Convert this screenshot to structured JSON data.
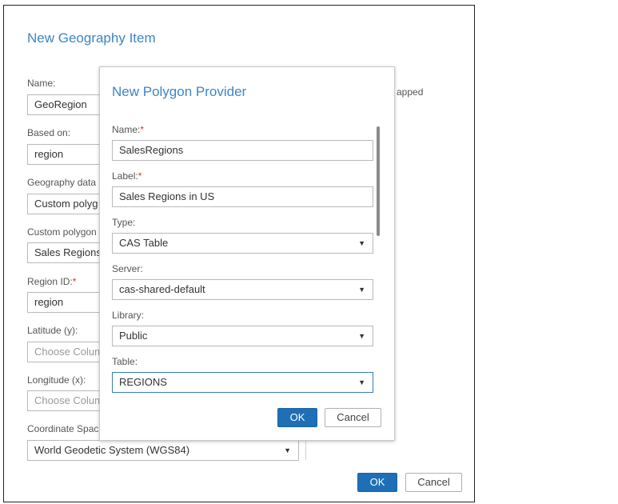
{
  "back_dialog": {
    "title": "New Geography Item",
    "name_label": "Name:",
    "name_value": "GeoRegion",
    "mapped_text": "apped",
    "based_on_label": "Based on:",
    "based_on_value": "region",
    "geo_data_label": "Geography data",
    "geo_data_value": "Custom polyg",
    "custom_polygon_label": "Custom polygon",
    "custom_polygon_value": "Sales Regions",
    "region_id_label": "Region ID:",
    "region_id_required": "*",
    "region_id_value": "region",
    "latitude_label": "Latitude (y):",
    "latitude_placeholder": "Choose Colum",
    "longitude_label": "Longitude (x):",
    "longitude_placeholder": "Choose Colum",
    "coord_label": "Coordinate Spac",
    "coord_value": "World Geodetic System (WGS84)",
    "ok_label": "OK",
    "cancel_label": "Cancel"
  },
  "polygon_dialog": {
    "title": "New Polygon Provider",
    "name_label": "Name:",
    "name_required": "*",
    "name_value": "SalesRegions",
    "label_label": "Label:",
    "label_required": "*",
    "label_value": "Sales Regions in US",
    "type_label": "Type:",
    "type_value": "CAS Table",
    "server_label": "Server:",
    "server_value": "cas-shared-default",
    "library_label": "Library:",
    "library_value": "Public",
    "table_label": "Table:",
    "table_value": "REGIONS",
    "ok_label": "OK",
    "cancel_label": "Cancel"
  },
  "icons": {
    "dropdown": "caret-down-icon"
  },
  "colors": {
    "accent": "#3d85c6",
    "primary_button": "#1e6fb5",
    "required": "#d9302c"
  }
}
